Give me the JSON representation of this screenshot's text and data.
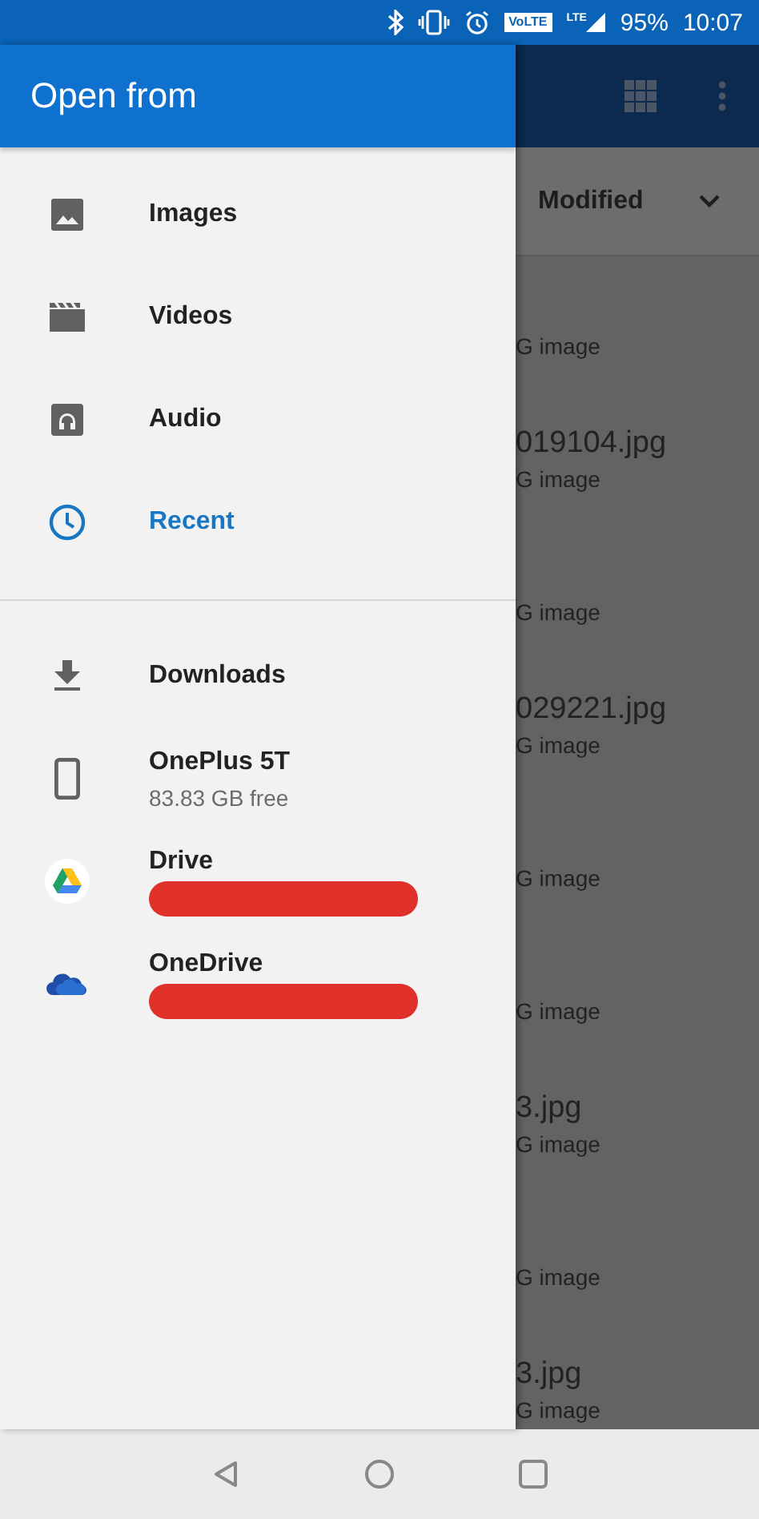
{
  "status_bar": {
    "volte": "VoLTE",
    "network": "LTE",
    "battery": "95%",
    "time": "10:07"
  },
  "drawer": {
    "title": "Open from",
    "sections": [
      {
        "items": [
          {
            "kind": "images",
            "label": "Images",
            "selected": false
          },
          {
            "kind": "videos",
            "label": "Videos",
            "selected": false
          },
          {
            "kind": "audio",
            "label": "Audio",
            "selected": false
          },
          {
            "kind": "recent",
            "label": "Recent",
            "selected": true
          }
        ]
      },
      {
        "items": [
          {
            "kind": "downloads",
            "label": "Downloads",
            "selected": false
          },
          {
            "kind": "device",
            "label": "OnePlus 5T",
            "subtitle": "83.83 GB free",
            "selected": false
          },
          {
            "kind": "drive",
            "label": "Drive",
            "redacted": true,
            "selected": false
          },
          {
            "kind": "onedrive",
            "label": "OneDrive",
            "redacted": true,
            "selected": false
          }
        ]
      }
    ]
  },
  "background": {
    "sort": {
      "label": "Modified"
    },
    "files": [
      {
        "subtitle": "G image"
      },
      {
        "name": "019104.jpg",
        "subtitle": "G image"
      },
      {
        "subtitle": "G image"
      },
      {
        "name": "029221.jpg",
        "subtitle": "G image"
      },
      {
        "subtitle": "G image"
      },
      {
        "subtitle": "G image"
      },
      {
        "name": "3.jpg",
        "subtitle": "G image"
      },
      {
        "subtitle": "G image"
      },
      {
        "name": "3.jpg",
        "subtitle": "G image"
      }
    ]
  }
}
